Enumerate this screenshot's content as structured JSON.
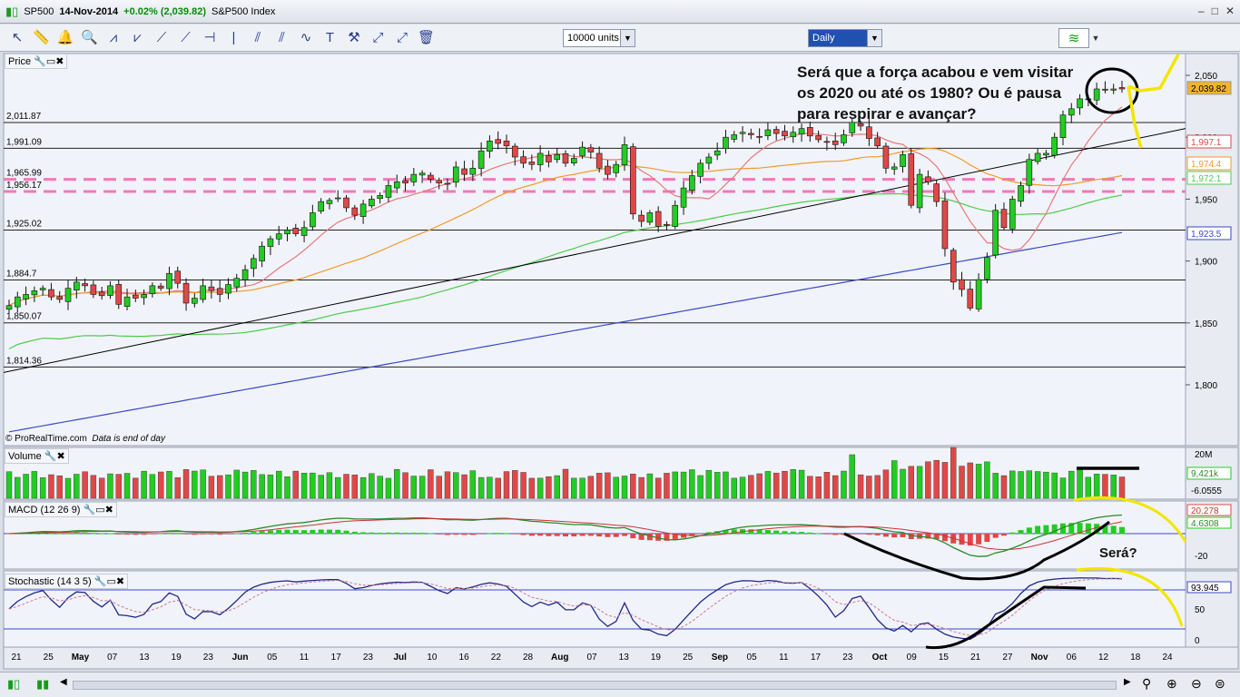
{
  "window": {
    "symbol": "SP500",
    "date": "14-Nov-2014",
    "change": "+0.02% (2,039.82)",
    "instrument": "S&P500 Index",
    "controls": [
      "–",
      "□",
      "✕"
    ]
  },
  "toolbar": {
    "units": "10000 units",
    "period": "Daily",
    "icons": [
      "cursor-icon",
      "ruler-icon",
      "alarm-bell-icon",
      "zoom-icon",
      "fibonacci-icon",
      "fibonacci-fan-icon",
      "trendline-icon",
      "ray-icon",
      "horizontal-line-icon",
      "vertical-line-icon",
      "channel-icon",
      "gann-icon",
      "wave-icon",
      "text-icon",
      "hammer-icon",
      "arrow-icon",
      "line-arrow-icon",
      "trash-icon"
    ]
  },
  "panels": {
    "price": {
      "title": "Price"
    },
    "volume": {
      "title": "Volume"
    },
    "macd": {
      "title": "MACD (12 26 9)"
    },
    "stoch": {
      "title": "Stochastic (14 3 5)"
    }
  },
  "footer": {
    "copyright": "© ProRealTime.com",
    "note": "Data is end of day"
  },
  "annotation": {
    "line1": "Será que a força acabou e vem visitar",
    "line2": "os 2020 ou até os 1980? Ou é pausa",
    "line3": "para respirar e avançar?",
    "sera": "Será?"
  },
  "colors": {
    "up": "#22cc22",
    "down": "#e04848",
    "ma1": "#e87878",
    "ma2": "#f09a28",
    "ma3": "#4ccc4c",
    "ma4": "#3a4ac8",
    "trend": "#000000",
    "dashed": "#f07ab8",
    "annotation_yellow": "#f2e600"
  },
  "chart_data": {
    "type": "candlestick",
    "y_axis": {
      "ticks": [
        1800,
        1850,
        1900,
        1950,
        2000,
        2050
      ],
      "range": [
        1755,
        2062
      ]
    },
    "x_ticks": [
      "21",
      "25",
      "May",
      "07",
      "13",
      "19",
      "23",
      "Jun",
      "05",
      "11",
      "17",
      "23",
      "Jul",
      "10",
      "16",
      "22",
      "28",
      "Aug",
      "07",
      "13",
      "19",
      "25",
      "Sep",
      "05",
      "11",
      "17",
      "23",
      "Oct",
      "09",
      "15",
      "21",
      "27",
      "Nov",
      "06",
      "12",
      "18",
      "24"
    ],
    "last_price": "2,039.82",
    "h_lines": [
      {
        "label": "2,011.87",
        "value": 2011.87
      },
      {
        "label": "1,991.09",
        "value": 1991.09
      },
      {
        "label": "1,965.99",
        "value": 1965.99,
        "style": "dashed"
      },
      {
        "label": "1,956.17",
        "value": 1956.17,
        "style": "dashed"
      },
      {
        "label": "1,925.02",
        "value": 1925.02
      },
      {
        "label": "1,884.7",
        "value": 1884.7
      },
      {
        "label": "1,850.07",
        "value": 1850.07
      },
      {
        "label": "1,814.36",
        "value": 1814.36
      }
    ],
    "ma_labels": [
      {
        "label": "1,997.1",
        "value": 1997.1
      },
      {
        "label": "1,974.4",
        "value": 1974.4
      },
      {
        "label": "1,972.1",
        "value": 1972.1
      },
      {
        "label": "1,923.5",
        "value": 1923.5
      }
    ],
    "closes": [
      1864,
      1871,
      1873,
      1876,
      1878,
      1871,
      1869,
      1878,
      1883,
      1880,
      1873,
      1872,
      1880,
      1865,
      1871,
      1870,
      1873,
      1880,
      1878,
      1890,
      1882,
      1866,
      1870,
      1880,
      1876,
      1873,
      1881,
      1886,
      1893,
      1902,
      1912,
      1918,
      1922,
      1925,
      1922,
      1927,
      1939,
      1948,
      1949,
      1951,
      1943,
      1937,
      1946,
      1950,
      1953,
      1961,
      1964,
      1963,
      1970,
      1971,
      1966,
      1963,
      1962,
      1976,
      1970,
      1975,
      1989,
      1997,
      1995,
      1993,
      1984,
      1979,
      1978,
      1987,
      1980,
      1986,
      1979,
      1983,
      1992,
      1988,
      1975,
      1970,
      1978,
      1994,
      1938,
      1932,
      1939,
      1928,
      1929,
      1945,
      1959,
      1969,
      1979,
      1984,
      1989,
      2000,
      2002,
      2004,
      2002,
      2000,
      2006,
      2003,
      2001,
      2004,
      2007,
      2001,
      1998,
      1996,
      1994,
      2002,
      2012,
      2009,
      1999,
      1993,
      1975,
      1976,
      1986,
      1945,
      1970,
      1964,
      1948,
      1910,
      1883,
      1877,
      1862,
      1885,
      1903,
      1941,
      1927,
      1950,
      1961,
      1982,
      1987,
      1987,
      2000,
      2018,
      2023,
      2031,
      2031,
      2039,
      2038,
      2039,
      2039
    ],
    "volume_legend": {
      "label_top": "20M",
      "value": "9,421k",
      "value2": "-6.0555"
    },
    "macd_legend": {
      "v1": "20.278",
      "v2": "4.6308",
      "tick": "-20"
    },
    "stoch_legend": {
      "v1": "93.945",
      "ticks": [
        "50",
        "0"
      ]
    }
  }
}
